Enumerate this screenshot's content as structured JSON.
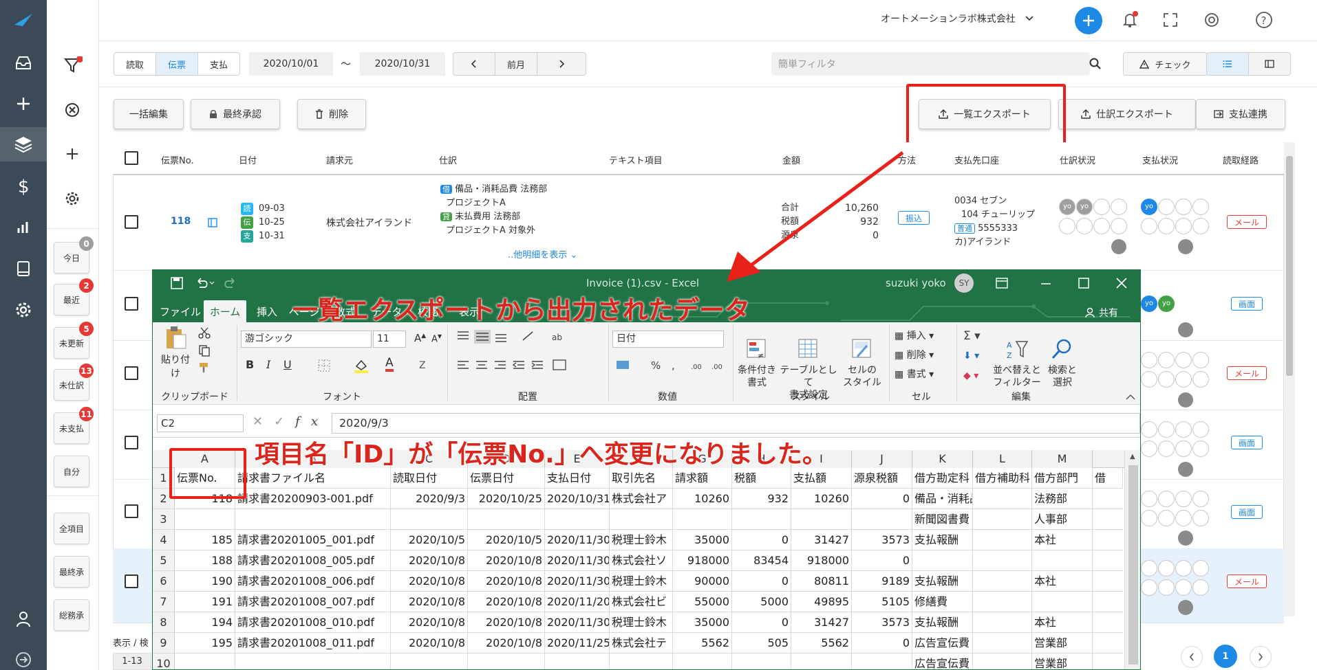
{
  "header": {
    "company": "オートメーションラボ株式会社",
    "filter_placeholder": "簡単フィルタ",
    "check_label": "チェック"
  },
  "toolbar": {
    "tabs": [
      "読取",
      "伝票",
      "支払"
    ],
    "date_from": "2020/10/01",
    "date_sep": "〜",
    "date_to": "2020/10/31",
    "prev_month": "前月",
    "bulk_edit": "一括編集",
    "final_approve": "最終承認",
    "delete": "削除",
    "list_export": "一覧エクスポート",
    "journal_export": "仕訳エクスポート",
    "payment_link": "支払連携"
  },
  "sidebar_filters": [
    {
      "label": "今日",
      "badge": "0"
    },
    {
      "label": "最近",
      "badge": "2"
    },
    {
      "label": "未更新",
      "badge": "5"
    },
    {
      "label": "未仕訳",
      "badge": "13"
    },
    {
      "label": "未支払",
      "badge": "11"
    },
    {
      "label": "自分",
      "badge": ""
    },
    {
      "label": "全項目",
      "badge": ""
    },
    {
      "label": "最終承",
      "badge": ""
    },
    {
      "label": "総務承",
      "badge": ""
    }
  ],
  "table": {
    "headers": [
      "伝票No.",
      "日付",
      "請求元",
      "仕訳",
      "テキスト項目",
      "金額",
      "方法",
      "支払先口座",
      "仕訳状況",
      "支払状況",
      "読取経路"
    ],
    "row1": {
      "id": "118",
      "dates": [
        {
          "tag": "読",
          "date": "09-03"
        },
        {
          "tag": "伝",
          "date": "10-25"
        },
        {
          "tag": "支",
          "date": "10-31"
        }
      ],
      "vendor": "株式会社アイランド",
      "journal": [
        {
          "tag": "借",
          "text": "備品・消耗品費  法務部"
        },
        {
          "tag": "",
          "text": "プロジェクトA"
        },
        {
          "tag": "貸",
          "text": "未払費用  法務部"
        },
        {
          "tag": "",
          "text": "プロジェクトA  対象外"
        }
      ],
      "more": "..他明細を表示",
      "amounts": [
        {
          "label": "合計",
          "value": "10,260"
        },
        {
          "label": "税額",
          "value": "932"
        },
        {
          "label": "源泉",
          "value": "0"
        }
      ],
      "method": "振込",
      "account": [
        "0034 セブン",
        "104 チューリップ",
        "普通",
        "5555333",
        "カ)アイランド"
      ],
      "avatar": "yo"
    },
    "routes": [
      "メール",
      "画面",
      "メール",
      "画面",
      "画面",
      "メール"
    ]
  },
  "footer": {
    "display": "表示 / 検",
    "range": "1-13",
    "page": "1"
  },
  "excel": {
    "title": "Invoice (1).csv  -  Excel",
    "user": "suzuki yoko",
    "initials": "SY",
    "tabs": [
      "ファイル",
      "ホーム",
      "挿入",
      "ページ",
      "数式",
      "データ",
      "校閲",
      "表示"
    ],
    "share": "共有",
    "paste": "貼り付け",
    "clipboard": "クリップボード",
    "font_name": "游ゴシック",
    "font_size": "11",
    "font_group": "フォント",
    "align_group": "配置",
    "number_format": "日付",
    "number_group": "数値",
    "cond_format": "条件付き\n書式",
    "table_format": "テーブルとして\n書式設定",
    "cell_style": "セルの\nスタイル",
    "style_group": "スタイル",
    "insert": "挿入",
    "delete": "削除",
    "format": "書式",
    "cell_group": "セル",
    "sort": "並べ替えと\nフィルター",
    "find": "検索と\n選択",
    "edit_group": "編集",
    "name_box": "C2",
    "formula": "2020/9/3",
    "columns": [
      "A",
      "B",
      "C",
      "D",
      "E",
      "F",
      "G",
      "H",
      "I",
      "J",
      "K",
      "L",
      "M"
    ],
    "rows": [
      [
        "伝票No.",
        "請求書ファイル名",
        "読取日付",
        "伝票日付",
        "支払日付",
        "取引先名",
        "請求額",
        "税額",
        "支払額",
        "源泉税額",
        "借方勘定科",
        "借方補助科",
        "借方部門"
      ],
      [
        "118",
        "請求書20200903-001.pdf",
        "2020/9/3",
        "2020/10/25",
        "2020/10/31",
        "株式会社ア",
        "10260",
        "932",
        "10260",
        "0",
        "備品・消耗品費",
        "",
        "法務部"
      ],
      [
        "",
        "",
        "",
        "",
        "",
        "",
        "",
        "",
        "",
        "",
        "新聞図書費",
        "",
        "人事部"
      ],
      [
        "185",
        "請求書20201005_001.pdf",
        "2020/10/5",
        "2020/10/5",
        "2020/11/30",
        "税理士鈴木",
        "35000",
        "0",
        "31427",
        "3573",
        "支払報酬",
        "",
        "本社"
      ],
      [
        "188",
        "請求書20201008_005.pdf",
        "2020/10/8",
        "2020/10/8",
        "2020/11/30",
        "株式会社ソ",
        "918000",
        "83454",
        "918000",
        "0",
        "",
        "",
        ""
      ],
      [
        "190",
        "請求書20201008_006.pdf",
        "2020/10/8",
        "2020/10/8",
        "2020/11/30",
        "税理士鈴木",
        "90000",
        "0",
        "80811",
        "9189",
        "支払報酬",
        "",
        "本社"
      ],
      [
        "191",
        "請求書20201008_007.pdf",
        "2020/10/8",
        "2020/10/8",
        "2020/11/20",
        "株式会社ビ",
        "55000",
        "5000",
        "49895",
        "5105",
        "修繕費",
        "",
        ""
      ],
      [
        "194",
        "請求書20201008_010.pdf",
        "2020/10/8",
        "2020/10/8",
        "2020/11/30",
        "税理士鈴木",
        "35000",
        "0",
        "31427",
        "3573",
        "支払報酬",
        "",
        "本社"
      ],
      [
        "195",
        "請求書20201008_011.pdf",
        "2020/10/8",
        "2020/10/8",
        "2020/11/25",
        "株式会社テ",
        "5562",
        "505",
        "5562",
        "0",
        "広告宣伝費",
        "",
        "営業部"
      ],
      [
        "",
        "",
        "",
        "",
        "",
        "",
        "",
        "",
        "",
        "",
        "広告宣伝費",
        "",
        "営業部"
      ]
    ],
    "extra_col_header": "借"
  },
  "annotations": {
    "title": "一覧エクスポートから出力されたデータ",
    "note": "項目名「ID」が「伝票No.」へ変更になりました。"
  },
  "colors": {
    "rail": "#3c4a57",
    "excel_green": "#217346",
    "accent": "#1e88e5",
    "annotation_red": "#e8211a"
  }
}
